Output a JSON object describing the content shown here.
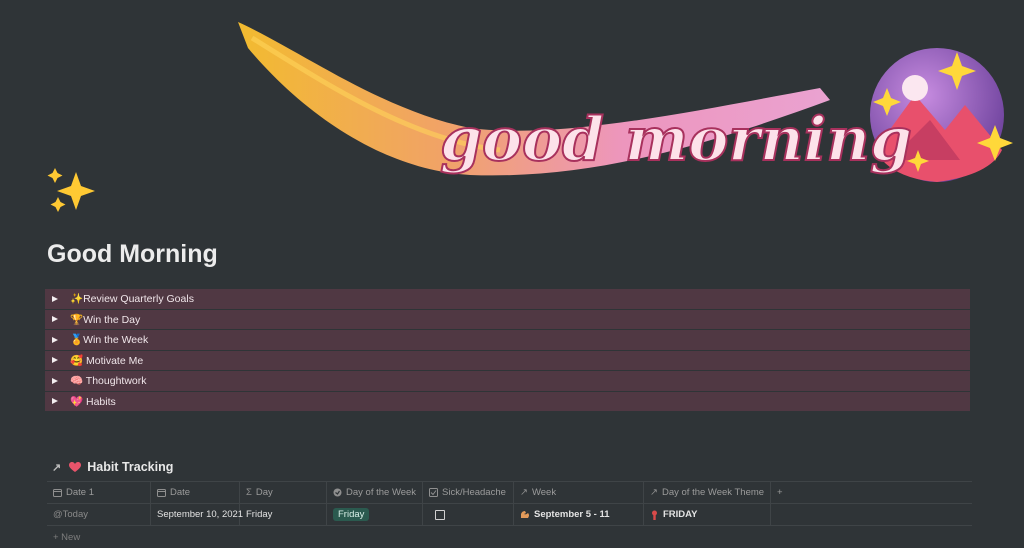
{
  "cover": {
    "text": "good morning"
  },
  "page": {
    "title": "Good Morning"
  },
  "toggles": [
    {
      "emoji": "sparkles-icon",
      "label": "✨Review Quarterly Goals"
    },
    {
      "emoji": "trophy-icon",
      "label": "🏆Win the Day"
    },
    {
      "emoji": "medal-icon",
      "label": "🏅Win the Week"
    },
    {
      "emoji": "smile-icon",
      "label": "🥰 Motivate Me"
    },
    {
      "emoji": "brain-icon",
      "label": "🧠 Thoughtwork"
    },
    {
      "emoji": "heart-icon",
      "label": "💖 Habits"
    }
  ],
  "database": {
    "title": "Habit Tracking",
    "columns": [
      {
        "icon": "calendar-icon",
        "label": "Date 1"
      },
      {
        "icon": "calendar-icon",
        "label": "Date"
      },
      {
        "icon": "sigma-icon",
        "label": "Day"
      },
      {
        "icon": "circle-dot-icon",
        "label": "Day of the Week"
      },
      {
        "icon": "checkbox-icon",
        "label": "Sick/Headache"
      },
      {
        "icon": "relation-arrow-icon",
        "label": "Week"
      },
      {
        "icon": "relation-arrow-icon",
        "label": "Day of the Week Theme"
      }
    ],
    "add_column": "+",
    "row": {
      "date1": "@Today",
      "date": "September 10, 2021",
      "day": "Friday",
      "day_of_week": "Friday",
      "sick": false,
      "week": "September 5 - 11",
      "theme": "FRIDAY"
    },
    "new_label": "+ New"
  }
}
